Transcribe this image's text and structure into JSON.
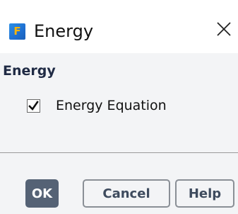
{
  "window": {
    "title": "Energy",
    "app_icon": {
      "name": "fluent-app-icon",
      "letter": "F"
    },
    "close_icon": "close-icon"
  },
  "panel": {
    "section_title": "Energy",
    "options": [
      {
        "label": "Energy Equation",
        "checked": true
      }
    ]
  },
  "buttons": {
    "ok_label": "OK",
    "cancel_label": "Cancel",
    "help_label": "Help"
  },
  "colors": {
    "primary_button": "#556275",
    "panel_background": "#f3f4f6",
    "section_title": "#1f2a44"
  }
}
